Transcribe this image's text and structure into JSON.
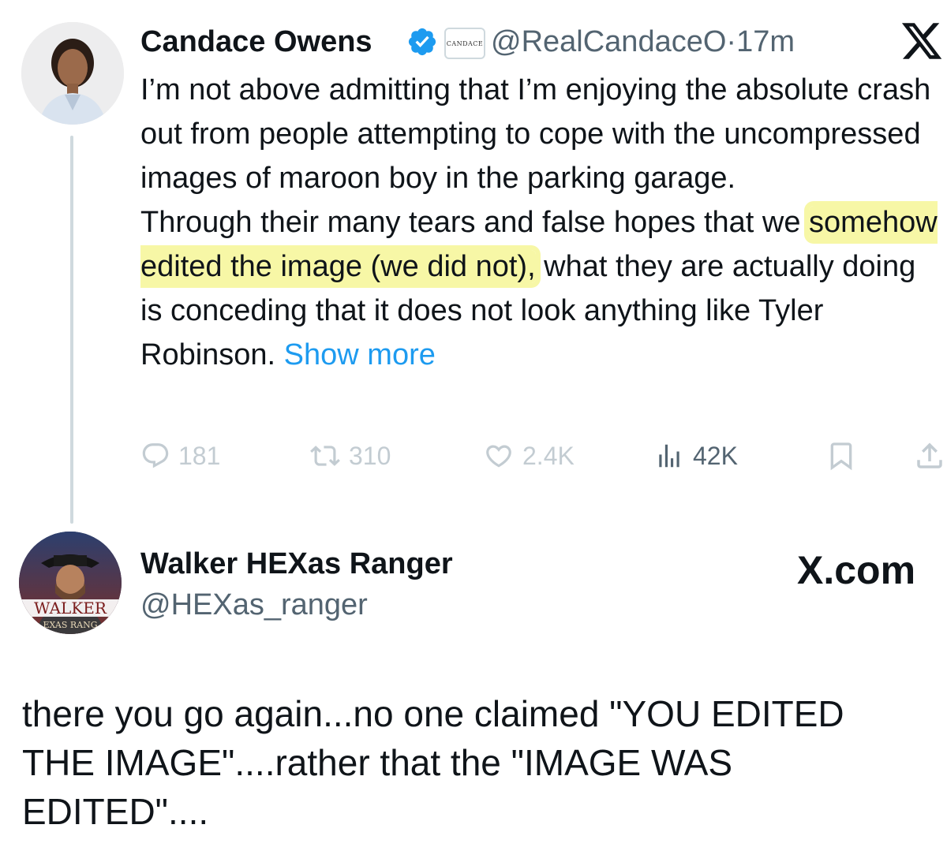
{
  "tweet": {
    "author_name": "Candace Owens",
    "affiliate_badge": "CANDACE",
    "handle": "@RealCandaceO",
    "separator": "·",
    "time": "17m",
    "text_part1": "I’m not above admitting that I’m enjoying the absolute crash out from people attempting to cope with the uncompressed images of maroon boy in the parking garage.",
    "text_part2_pre": "Through their many tears and false hopes that we ",
    "text_part2_highlight": "somehow edited the image (we did not),",
    "text_part2_post": " what they are actually doing is conceding that it does not look anything like Tyler Robinson. ",
    "show_more": "Show more",
    "stats": {
      "replies": "181",
      "reposts": "310",
      "likes": "2.4K",
      "views": "42K"
    },
    "colors": {
      "link": "#1d9bf0",
      "highlight": "#f7f7a6",
      "verified": "#1d9bf0"
    }
  },
  "reply": {
    "author_name": "Walker HEXas Ranger",
    "handle": "@HEXas_ranger",
    "avatar_text_1": "WALKER",
    "avatar_text_2": "EXAS RANG",
    "watermark": "X.com",
    "text": "there you go again...no one claimed \"YOU EDITED THE IMAGE\"....rather that the \"IMAGE WAS EDITED\"...."
  },
  "icons": [
    "verified-badge-icon",
    "x-logo-icon",
    "reply-icon",
    "repost-icon",
    "like-icon",
    "views-icon",
    "bookmark-icon",
    "share-icon"
  ]
}
